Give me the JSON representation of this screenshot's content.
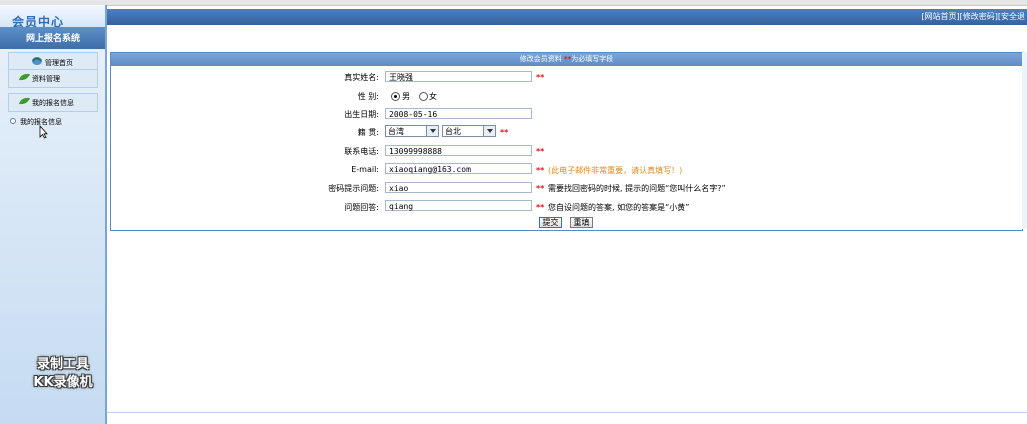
{
  "sidebar": {
    "logo": "会员中心",
    "system_title": "网上报名系统",
    "items": [
      {
        "label": "管理首页"
      },
      {
        "label": "资料管理"
      },
      {
        "label": "我的报名信息"
      }
    ],
    "submenu": {
      "label": "我的报名信息"
    },
    "watermark": [
      "录制工具",
      "KK录像机"
    ]
  },
  "topbar": {
    "links": [
      "[网站首页]",
      "[修改密码]",
      "[安全退"
    ]
  },
  "form": {
    "header_prefix": "修改会员资料",
    "header_star": "**",
    "header_suffix": "为必填写字段",
    "required_mark": "**",
    "fields": {
      "realname": {
        "label": "真实姓名:",
        "value": "王晓强"
      },
      "gender": {
        "label": "性    别:",
        "options": [
          "男",
          "女"
        ],
        "selected": "男"
      },
      "birthday": {
        "label": "出生日期:",
        "value": "2008-05-16"
      },
      "native": {
        "label": "籍    贯:",
        "province": "台湾",
        "city": "台北"
      },
      "phone": {
        "label": "联系电话:",
        "value": "13099998888"
      },
      "email": {
        "label": "E-mail:",
        "value": "xiaoqiang@163.com",
        "note": "(此电子邮件非常重要，请认真填写！)"
      },
      "question": {
        "label": "密码提示问题:",
        "value": "xiao",
        "note": "需要找回密码的时候, 提示的问题“您叫什么名字?”"
      },
      "answer": {
        "label": "问题回答:",
        "value": "qiang",
        "note": "您自设问题的答案, 如您的答案是“小黄”"
      }
    },
    "submit_label": "提交",
    "reset_label": "重填"
  },
  "colors": {
    "header_blue": "#5d8cc6",
    "required_red": "#e0141c",
    "note_orange": "#e08a1c"
  }
}
